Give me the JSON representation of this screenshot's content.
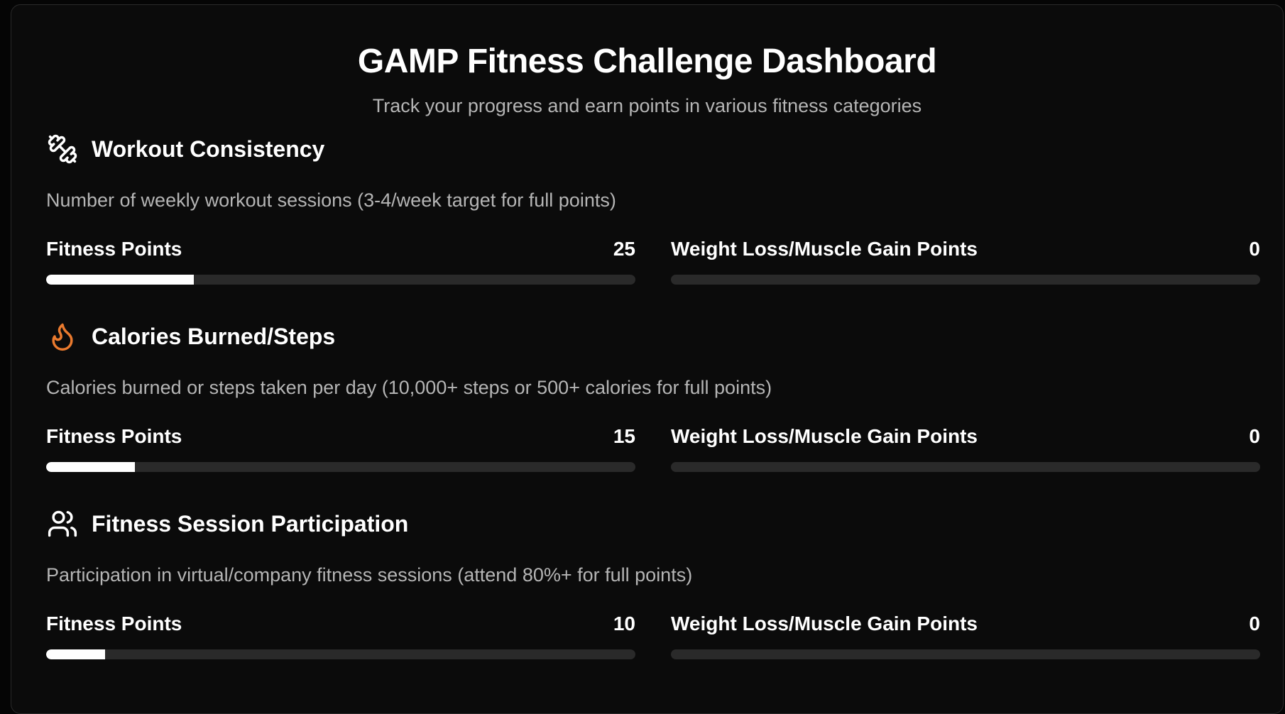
{
  "header": {
    "title": "GAMP Fitness Challenge Dashboard",
    "subtitle": "Track your progress and earn points in various fitness categories"
  },
  "colors": {
    "bar_fill": "#ffffff",
    "bar_track": "#2a2a2a",
    "flame_icon": "#ea7a2e"
  },
  "sections": [
    {
      "icon": "dumbbell-icon",
      "title": "Workout Consistency",
      "description": "Number of weekly workout sessions (3-4/week target for full points)",
      "fitness": {
        "label": "Fitness Points",
        "value": "25",
        "fill_percent": 25
      },
      "weight": {
        "label": "Weight Loss/Muscle Gain Points",
        "value": "0",
        "fill_percent": 0
      }
    },
    {
      "icon": "flame-icon",
      "title": "Calories Burned/Steps",
      "description": "Calories burned or steps taken per day (10,000+ steps or 500+ calories for full points)",
      "fitness": {
        "label": "Fitness Points",
        "value": "15",
        "fill_percent": 15
      },
      "weight": {
        "label": "Weight Loss/Muscle Gain Points",
        "value": "0",
        "fill_percent": 0
      }
    },
    {
      "icon": "users-icon",
      "title": "Fitness Session Participation",
      "description": "Participation in virtual/company fitness sessions (attend 80%+ for full points)",
      "fitness": {
        "label": "Fitness Points",
        "value": "10",
        "fill_percent": 10
      },
      "weight": {
        "label": "Weight Loss/Muscle Gain Points",
        "value": "0",
        "fill_percent": 0
      }
    }
  ]
}
